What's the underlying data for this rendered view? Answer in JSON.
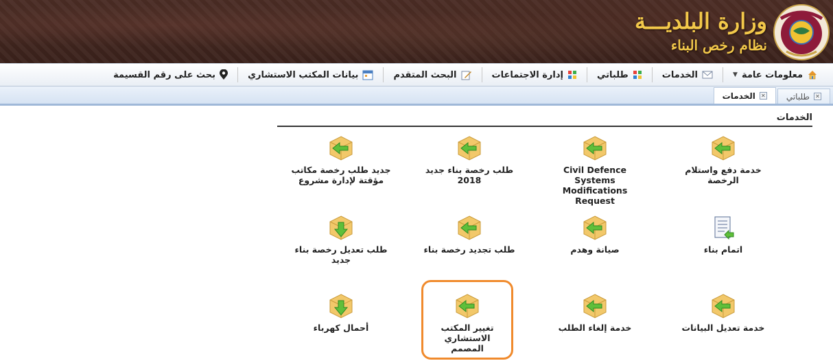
{
  "header": {
    "title": "وزارة البلديـــة",
    "subtitle": "نظام رخص البناء",
    "emblem_icon": "ministry-emblem-icon"
  },
  "menu": {
    "items": [
      {
        "label": "معلومات عامة",
        "icon": "home-icon",
        "dropdown": true
      },
      {
        "label": "الخدمات",
        "icon": "envelope-icon"
      },
      {
        "label": "طلباتي",
        "icon": "tiles-icon"
      },
      {
        "label": "إدارة الاجتماعات",
        "icon": "tiles-icon"
      },
      {
        "label": "البحث المتقدم",
        "icon": "edit-icon"
      },
      {
        "label": "بيانات المكتب الاستشاري",
        "icon": "calendar-icon"
      },
      {
        "label": "بحث على رقم القسيمة",
        "icon": "map-pin-icon"
      }
    ]
  },
  "tabs": [
    {
      "label": "طلباتي",
      "active": false
    },
    {
      "label": "الخدمات",
      "active": true
    }
  ],
  "section": {
    "title": "الخدمات"
  },
  "services": [
    {
      "label": "خدمة دفع واستلام الرخصة",
      "icon": "cube-arrow-icon"
    },
    {
      "label": "Civil Defence Systems Modifications Request",
      "icon": "cube-arrow-icon"
    },
    {
      "label": "طلب رخصة بناء جديد 2018",
      "icon": "cube-arrow-icon"
    },
    {
      "label": "جديد طلب رخصة مكاتب مؤقتة لإدارة مشروع",
      "icon": "cube-arrow-icon"
    },
    {
      "label": "اتمام بناء",
      "icon": "document-icon"
    },
    {
      "label": "صيانة وهدم",
      "icon": "cube-arrow-icon"
    },
    {
      "label": "طلب تجديد رخصة بناء",
      "icon": "cube-arrow-icon"
    },
    {
      "label": "طلب تعديل رخصة بناء جديد",
      "icon": "cube-down-arrow-icon"
    },
    {
      "label": "خدمة تعديل البيانات",
      "icon": "cube-arrow-icon"
    },
    {
      "label": "خدمة إلغاء الطلب",
      "icon": "cube-arrow-icon"
    },
    {
      "label": "تغيير المكتب الاستشاري المصمم",
      "icon": "cube-arrow-icon",
      "highlighted": true
    },
    {
      "label": "أحمال كهرباء",
      "icon": "cube-down-arrow-icon"
    }
  ],
  "colors": {
    "banner": "#3f251e",
    "title_gold": "#f2c84a",
    "highlight": "#f08a2c",
    "tab_border": "#9fb8d8"
  }
}
